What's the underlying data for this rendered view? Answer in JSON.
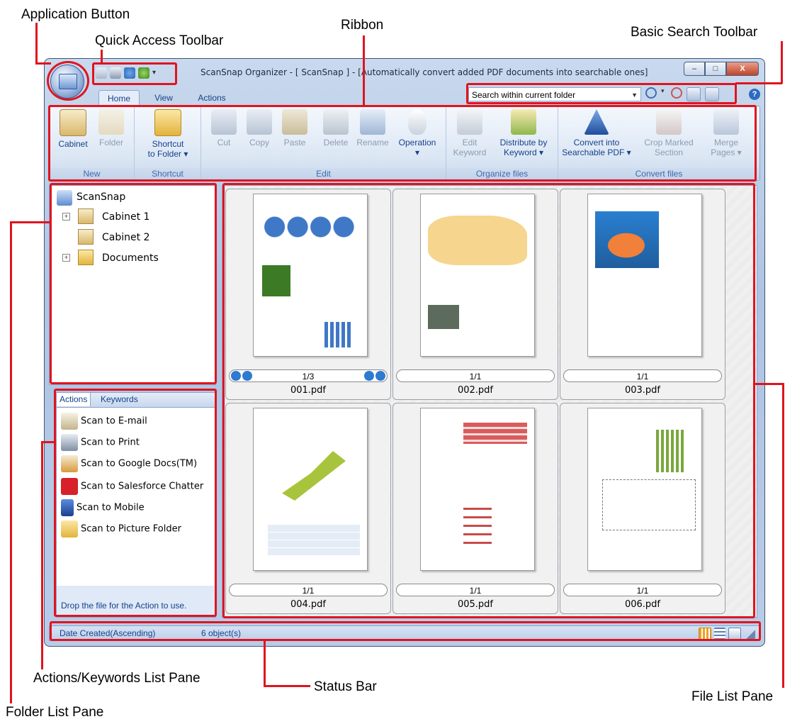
{
  "callouts": {
    "application_button": "Application Button",
    "quick_access_toolbar": "Quick Access Toolbar",
    "ribbon": "Ribbon",
    "basic_search_toolbar": "Basic Search Toolbar",
    "actions_keywords_list_pane": "Actions/Keywords List Pane",
    "status_bar": "Status Bar",
    "file_list_pane": "File List Pane",
    "folder_list_pane": "Folder List Pane"
  },
  "window": {
    "title": "ScanSnap Organizer - [ ScanSnap ] - [Automatically convert added PDF documents into searchable ones]",
    "buttons": {
      "minimize": "–",
      "maximize": "□",
      "close": "X"
    }
  },
  "tabs": [
    "Home",
    "View",
    "Actions"
  ],
  "search": {
    "value": "Search within current folder"
  },
  "ribbon": {
    "groups": {
      "new": "New",
      "shortcut": "Shortcut",
      "edit": "Edit",
      "organize": "Organize files",
      "convert": "Convert files"
    },
    "buttons": {
      "cabinet": "Cabinet",
      "folder": "Folder",
      "shortcut_l1": "Shortcut",
      "shortcut_l2": "to Folder ▾",
      "cut": "Cut",
      "copy": "Copy",
      "paste": "Paste",
      "delete": "Delete",
      "rename": "Rename",
      "operation": "Operation",
      "operation_arrow": "▾",
      "edit_kw_l1": "Edit",
      "edit_kw_l2": "Keyword",
      "distribute_l1": "Distribute by",
      "distribute_l2": "Keyword ▾",
      "convert_l1": "Convert into",
      "convert_l2": "Searchable PDF ▾",
      "crop_l1": "Crop Marked",
      "crop_l2": "Section",
      "merge_l1": "Merge",
      "merge_l2": "Pages ▾"
    }
  },
  "folders": {
    "root": "ScanSnap",
    "items": [
      "Cabinet 1",
      "Cabinet 2",
      "Documents"
    ]
  },
  "actions_pane": {
    "tabs": [
      "Actions",
      "Keywords"
    ],
    "items": [
      "Scan to E-mail",
      "Scan to Print",
      "Scan to Google Docs(TM)",
      "Scan to Salesforce Chatter",
      "Scan to Mobile",
      "Scan to Picture Folder"
    ],
    "hint": "Drop the file for the Action to use."
  },
  "files": [
    {
      "name": "001.pdf",
      "pages": "1/3"
    },
    {
      "name": "002.pdf",
      "pages": "1/1"
    },
    {
      "name": "003.pdf",
      "pages": "1/1"
    },
    {
      "name": "004.pdf",
      "pages": "1/1"
    },
    {
      "name": "005.pdf",
      "pages": "1/1"
    },
    {
      "name": "006.pdf",
      "pages": "1/1"
    }
  ],
  "status": {
    "sort": "Date Created(Ascending)",
    "count": "6 object(s)"
  },
  "colors": {
    "callout_red": "#e0141e",
    "ribbon_text": "#15428b"
  }
}
